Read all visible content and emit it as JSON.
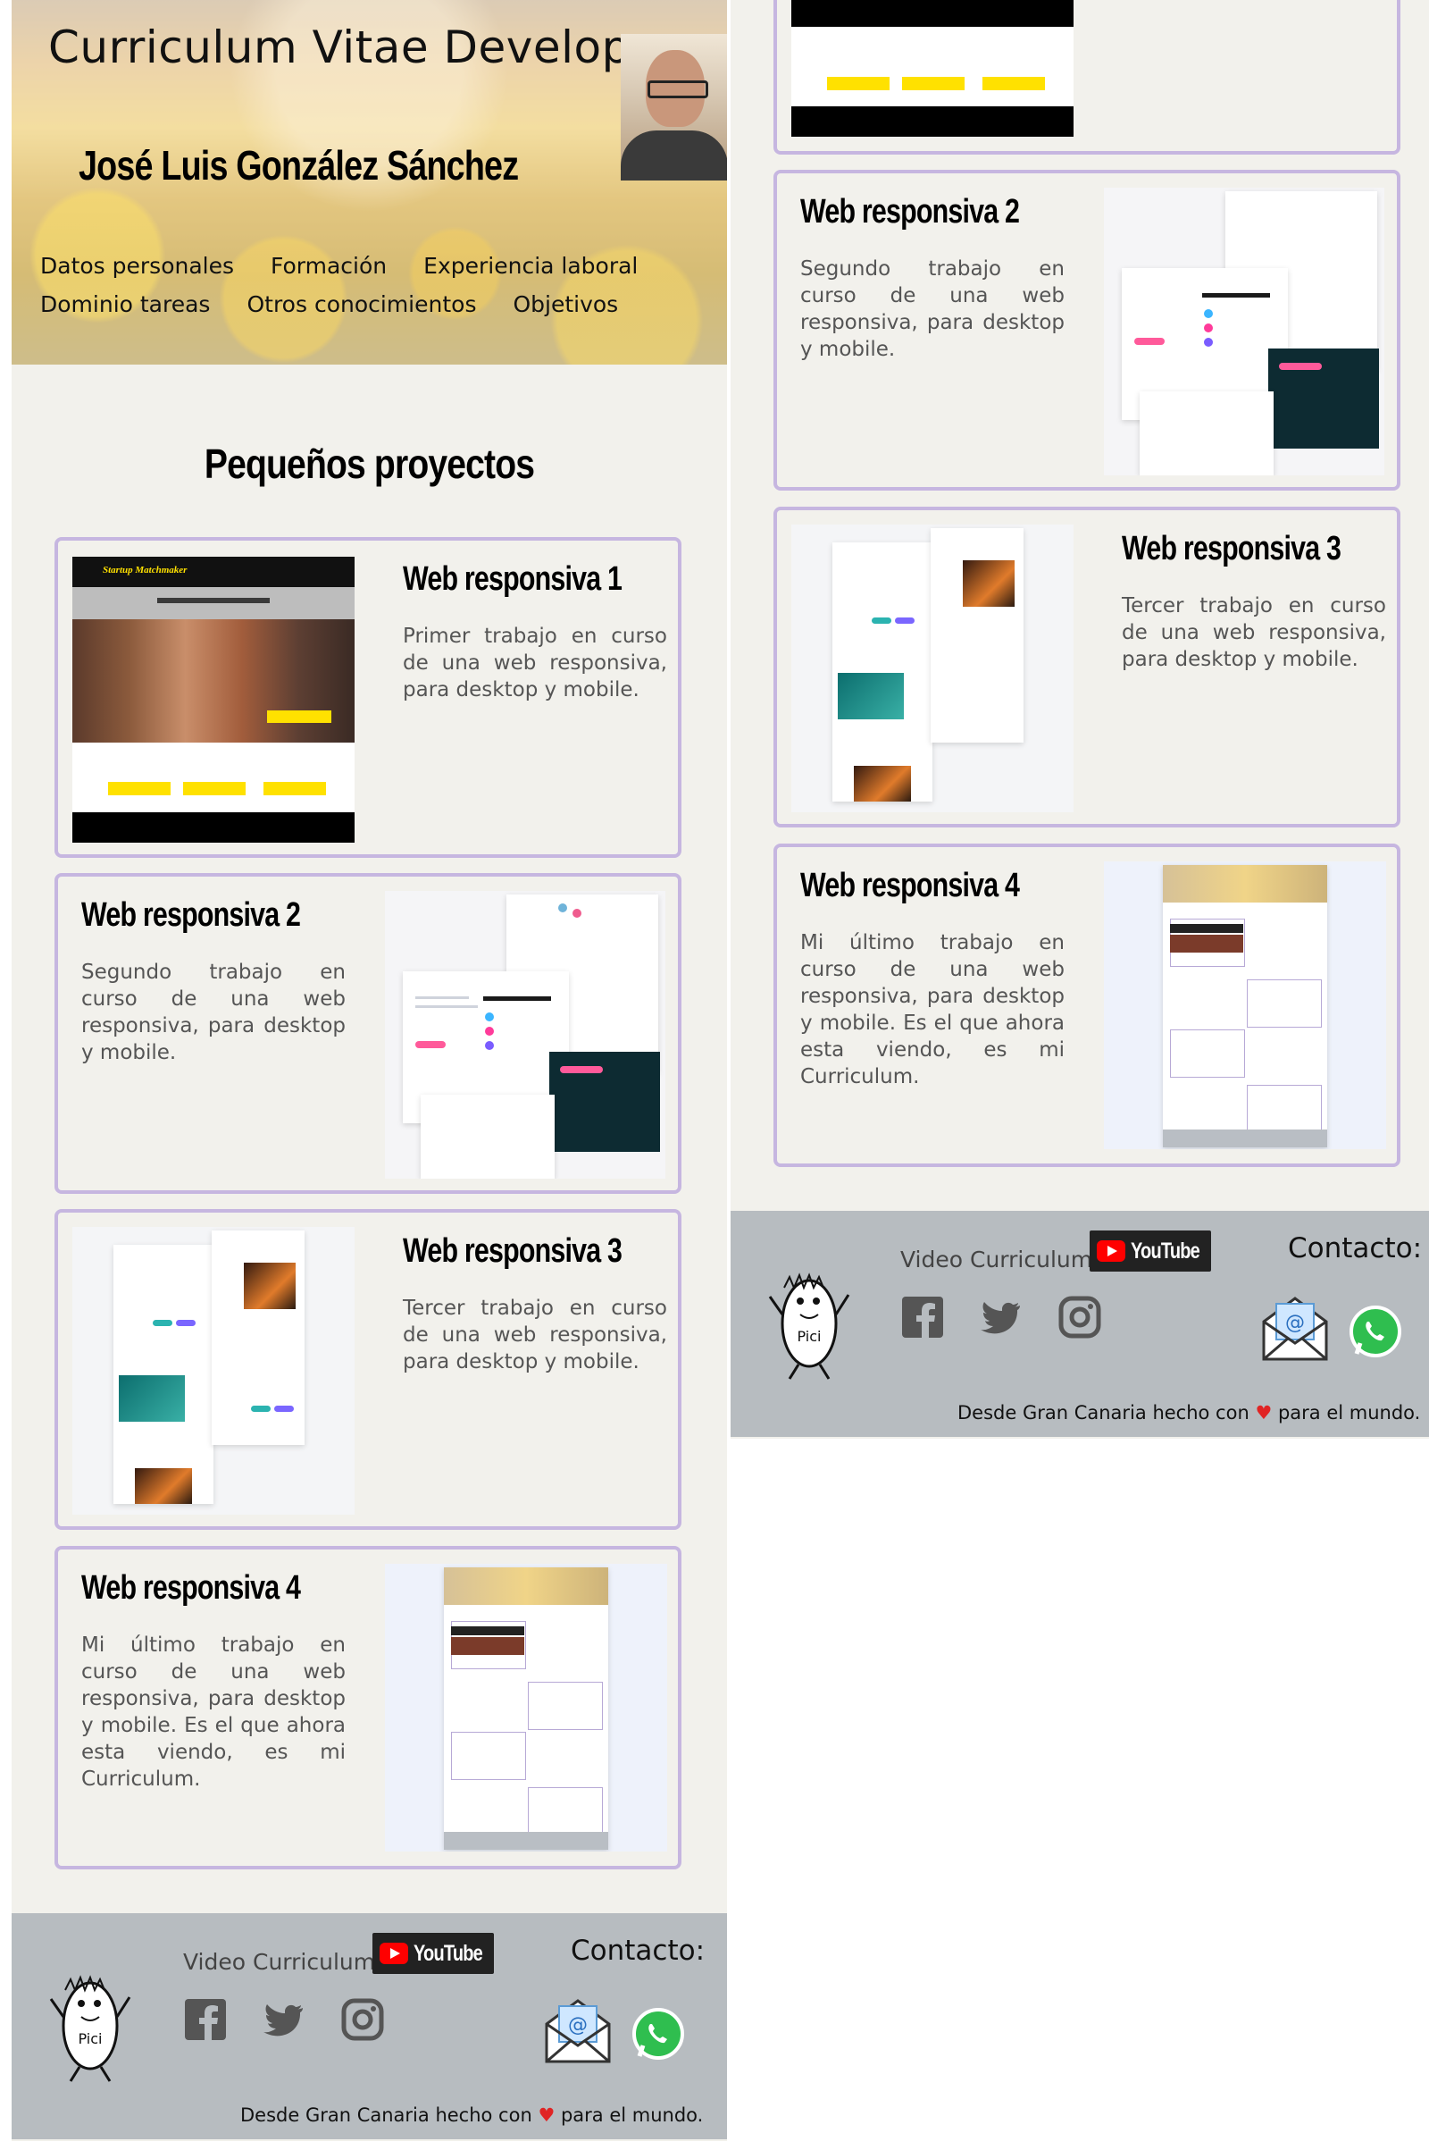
{
  "header": {
    "title": "Curriculum Vitae Developer",
    "name": "José Luis González Sánchez",
    "nav": [
      "Datos personales",
      "Formación",
      "Experiencia laboral",
      "Dominio tareas",
      "Otros conocimientos",
      "Objetivos"
    ]
  },
  "projects": {
    "section_title": "Pequeños proyectos",
    "items": [
      {
        "title": "Web responsiva 1",
        "description": "Primer trabajo en curso de una web responsiva, para desktop y mobile."
      },
      {
        "title": "Web responsiva 2",
        "description": "Segundo trabajo en curso de una web responsiva, para desktop y mobile."
      },
      {
        "title": "Web responsiva 3",
        "description": "Tercer trabajo en curso de una web responsiva, para desktop y mobile."
      },
      {
        "title": "Web responsiva 4",
        "description": "Mi último trabajo en curso de una web responsiva, para desktop y mobile. Es el que ahora esta viendo, es mi Curriculum."
      }
    ]
  },
  "thumbnails": {
    "startup_brand": "Startup Matchmaker"
  },
  "footer": {
    "mascot_label": "Pici",
    "video_label": "Video Curriculum:",
    "youtube_label": "YouTube",
    "contact_label": "Contacto:",
    "made_prefix": "Desde Gran Canaria hecho con",
    "heart": "♥",
    "made_suffix": "para el mundo.",
    "social_icons": [
      "facebook-icon",
      "twitter-icon",
      "instagram-icon"
    ],
    "contact_icons": [
      "email-icon",
      "whatsapp-icon"
    ]
  },
  "colors": {
    "card_border": "#c6b6e0",
    "page_bg": "#f2f1ec",
    "footer_bg": "#b7bcc0",
    "accent_yellow": "#ffe100",
    "heart_red": "#e02424"
  }
}
